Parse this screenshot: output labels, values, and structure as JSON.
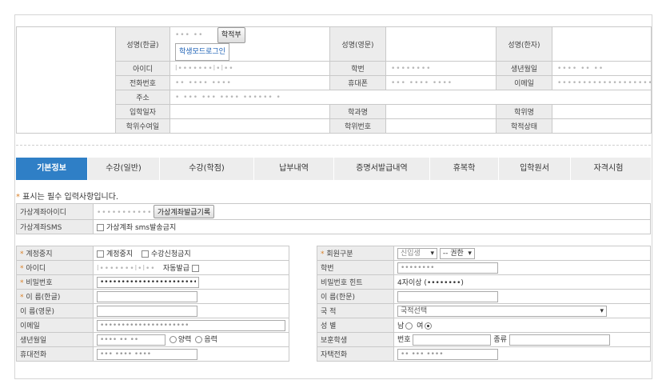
{
  "profile": {
    "name_kr_label": "성명(한글)",
    "name_kr_value": "••• ••",
    "academic_btn": "학적부",
    "student_mode_btn": "학생모드로그인",
    "name_en_label": "성명(영문)",
    "name_cn_label": "성명(한자)",
    "id_label": "아이디",
    "id_value": "l•••••••l•l••",
    "student_no_label": "학번",
    "student_no_value": "••••••••",
    "birth_label": "생년월일",
    "birth_value": "•••• •• ••",
    "phone_label": "전화번호",
    "phone_value": "•• •••• ••••",
    "mobile_label": "휴대폰",
    "mobile_value": "••• •••• ••••",
    "email_label": "이메일",
    "email_value": "••••••••••••••••••••",
    "address_label": "주소",
    "address_value": "• ••• ••• ••••    •••••• •",
    "entrance_label": "입학일자",
    "dept_label": "학과명",
    "degree_label": "학위명",
    "degree_date_label": "학위수여일",
    "degree_no_label": "학위번호",
    "status_label": "학적상태"
  },
  "tabs": [
    "기본정보",
    "수강(일반)",
    "수강(학점)",
    "납부내역",
    "증명서발급내역",
    "휴복학",
    "입학원서",
    "자격시험"
  ],
  "notice": {
    "star": "*",
    "text": " 표시는 필수 입력사항입니다."
  },
  "virtual": {
    "id_label": "가상계좌아이디",
    "id_value": "••••••••••••••••",
    "issue_btn": "가상계좌발급기록",
    "sms_label": "가상계좌SMS",
    "sms_option": "가상계좌 sms발송금지"
  },
  "form_left": {
    "suspend_label": "계정중지",
    "suspend_opt1": "계정중지",
    "suspend_opt2": "수강신청금지",
    "id_label": "아이디",
    "id_value": "l•••••••l•l••",
    "auto_issue": "자동발급",
    "password_label": "비밀번호",
    "password_value": "••••••••••••••••••••••••••",
    "name_kr_label": "이 름(한글)",
    "name_en_label": "이 름(영문)",
    "email_label": "이메일",
    "email_value": "•••••••••••••••••••••",
    "birth_label": "생년월일",
    "birth_value": "•••• •• ••",
    "solar": "양력",
    "lunar": "음력",
    "mobile_label": "휴대전화",
    "mobile_value": "••• •••• ••••"
  },
  "form_right": {
    "member_type_label": "회원구분",
    "member_type_value": "신입생",
    "auth_value": "-- 권한",
    "student_no_label": "학번",
    "student_no_value": "••••••••",
    "pw_hint_label": "비밀번호 힌트",
    "pw_hint_value": "4자이상 (••••••••)",
    "name_cn_label": "이 름(한문)",
    "nation_label": "국 적",
    "nation_value": "국적선택",
    "gender_label": "성 별",
    "male": "남",
    "female": "여",
    "veteran_label": "보훈학생",
    "veteran_no": "번호",
    "veteran_type": "종류",
    "home_phone_label": "자택전화",
    "home_phone_value": "•• ••• ••••"
  }
}
